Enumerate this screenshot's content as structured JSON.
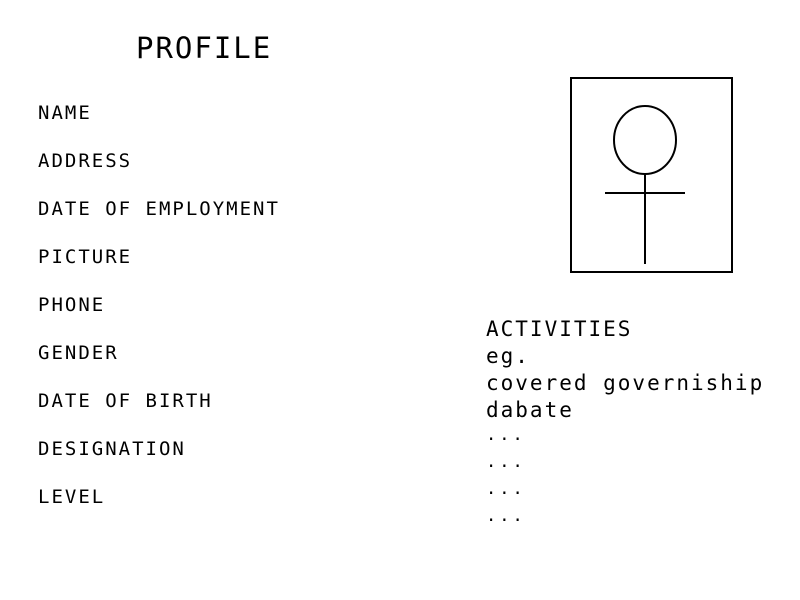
{
  "header": {
    "title": "PROFILE"
  },
  "fields": [
    "NAME",
    "ADDRESS",
    "DATE OF EMPLOYMENT",
    "PICTURE",
    "PHONE",
    "GENDER",
    "DATE OF BIRTH",
    "DESIGNATION",
    "LEVEL"
  ],
  "picture": {
    "icon": "person-placeholder-icon"
  },
  "activities": {
    "heading": "ACTIVITIES",
    "example_label": "eg.",
    "items": [
      "covered governiship",
      "dabate"
    ],
    "ellipses": [
      "...",
      "...",
      "...",
      "..."
    ]
  }
}
